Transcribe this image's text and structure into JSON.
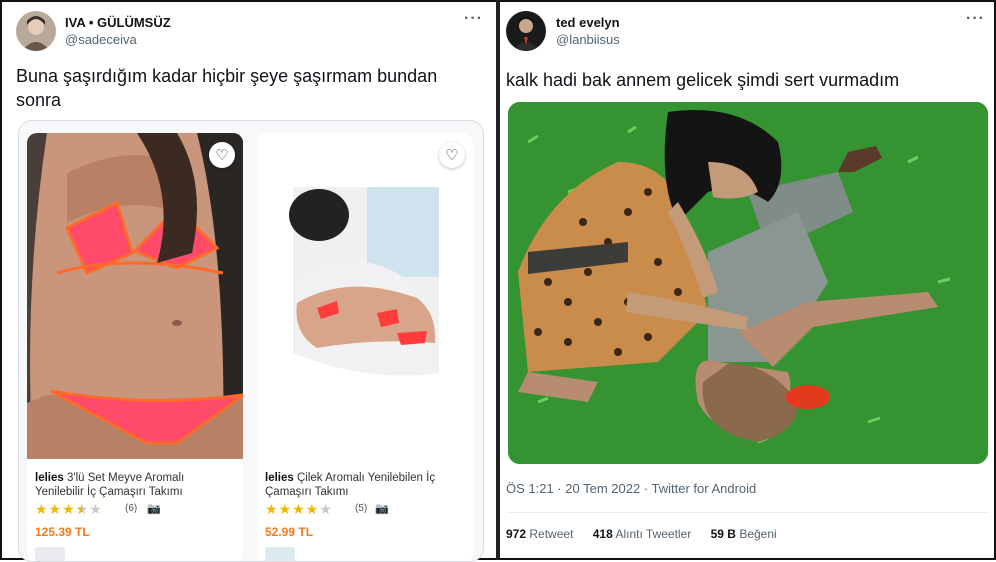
{
  "left_tweet": {
    "name": "IVA • GÜLÜMSÜZ",
    "handle": "@sadeceiva",
    "text": "Buna şaşırdığım kadar hiçbir şeye şaşırmam bundan sonra",
    "products": [
      {
        "brand": "lelies",
        "title": "3'lü Set Meyve Aromalı Yenilebilir İç Çamaşırı Takımı",
        "rating": 3.5,
        "review_count": "(6)",
        "price": "125.39 TL"
      },
      {
        "brand": "lelies",
        "title": "Çilek Aromalı Yenilebilen İç Çamaşırı Takımı",
        "rating": 4,
        "review_count": "(5)",
        "price": "52.99 TL"
      }
    ]
  },
  "right_tweet": {
    "name": "ted evelyn",
    "handle": "@lanbiisus",
    "text": "kalk hadi bak annem gelicek şimdi sert vurmadım",
    "meta": "ÖS 1:21 · 20 Tem 2022 · Twitter for Android",
    "stats": {
      "retweets": "972",
      "retweets_label": "Retweet",
      "quotes": "418",
      "quotes_label": "Alıntı Tweetler",
      "likes": "59 B",
      "likes_label": "Beğeni"
    }
  },
  "icons": {
    "more": "more-dots-icon",
    "heart": "heart-icon",
    "camera": "camera-icon",
    "star": "star-icon"
  },
  "colors": {
    "price": "#f27a1a",
    "star": "#f2b600",
    "secondary_text": "#536471"
  }
}
